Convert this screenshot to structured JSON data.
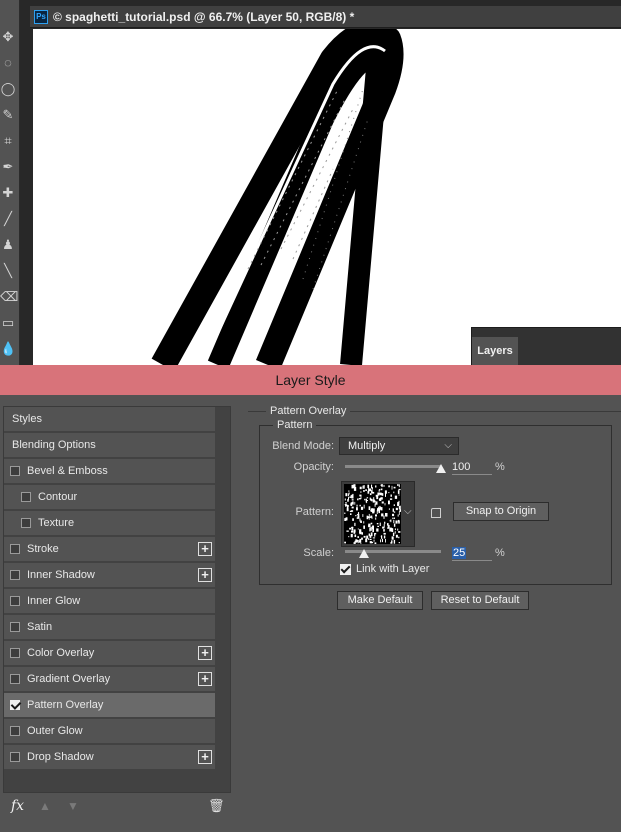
{
  "app": {
    "doc_title": "© spaghetti_tutorial.psd @ 66.7% (Layer 50, RGB/8) *",
    "ps_badge": "Ps",
    "tools": [
      "move-icon",
      "marquee-icon",
      "lasso-icon",
      "quick-select-icon",
      "crop-icon",
      "eyedropper-icon",
      "healing-icon",
      "brush-icon",
      "stamp-icon",
      "history-brush-icon",
      "eraser-icon",
      "gradient-icon",
      "blur-icon"
    ],
    "layers_tab": "Layers"
  },
  "dialog": {
    "title": "Layer Style",
    "styles": [
      {
        "label": "Styles",
        "checkbox": false,
        "checked": false,
        "plus": false
      },
      {
        "label": "Blending Options",
        "checkbox": false,
        "checked": false,
        "plus": false
      },
      {
        "label": "Bevel & Emboss",
        "checkbox": true,
        "checked": false,
        "plus": false
      },
      {
        "label": "Contour",
        "checkbox": true,
        "checked": false,
        "plus": false,
        "indent": true
      },
      {
        "label": "Texture",
        "checkbox": true,
        "checked": false,
        "plus": false,
        "indent": true
      },
      {
        "label": "Stroke",
        "checkbox": true,
        "checked": false,
        "plus": true
      },
      {
        "label": "Inner Shadow",
        "checkbox": true,
        "checked": false,
        "plus": true
      },
      {
        "label": "Inner Glow",
        "checkbox": true,
        "checked": false,
        "plus": false
      },
      {
        "label": "Satin",
        "checkbox": true,
        "checked": false,
        "plus": false
      },
      {
        "label": "Color Overlay",
        "checkbox": true,
        "checked": false,
        "plus": true
      },
      {
        "label": "Gradient Overlay",
        "checkbox": true,
        "checked": false,
        "plus": true
      },
      {
        "label": "Pattern Overlay",
        "checkbox": true,
        "checked": true,
        "plus": false,
        "active": true
      },
      {
        "label": "Outer Glow",
        "checkbox": true,
        "checked": false,
        "plus": false
      },
      {
        "label": "Drop Shadow",
        "checkbox": true,
        "checked": false,
        "plus": true
      }
    ],
    "bottom_bar": {
      "fx": "fx",
      "up": "▲",
      "down": "▼",
      "trash": "🗑"
    },
    "panel": {
      "section_title": "Pattern Overlay",
      "group_title": "Pattern",
      "blend_mode_label": "Blend Mode:",
      "blend_mode_value": "Multiply",
      "opacity_label": "Opacity:",
      "opacity_value": "100",
      "opacity_fraction": 1.0,
      "opacity_unit": "%",
      "pattern_label": "Pattern:",
      "snap_button": "Snap to Origin",
      "scale_label": "Scale:",
      "scale_value": "25",
      "scale_fraction": 0.2,
      "scale_unit": "%",
      "link_label": "Link with Layer",
      "link_checked": true,
      "make_default": "Make Default",
      "reset_default": "Reset to Default"
    }
  },
  "colors": {
    "titlebar": "#d8737a",
    "dialog_bg": "#535353",
    "selected_row": "#6a6a6a"
  }
}
